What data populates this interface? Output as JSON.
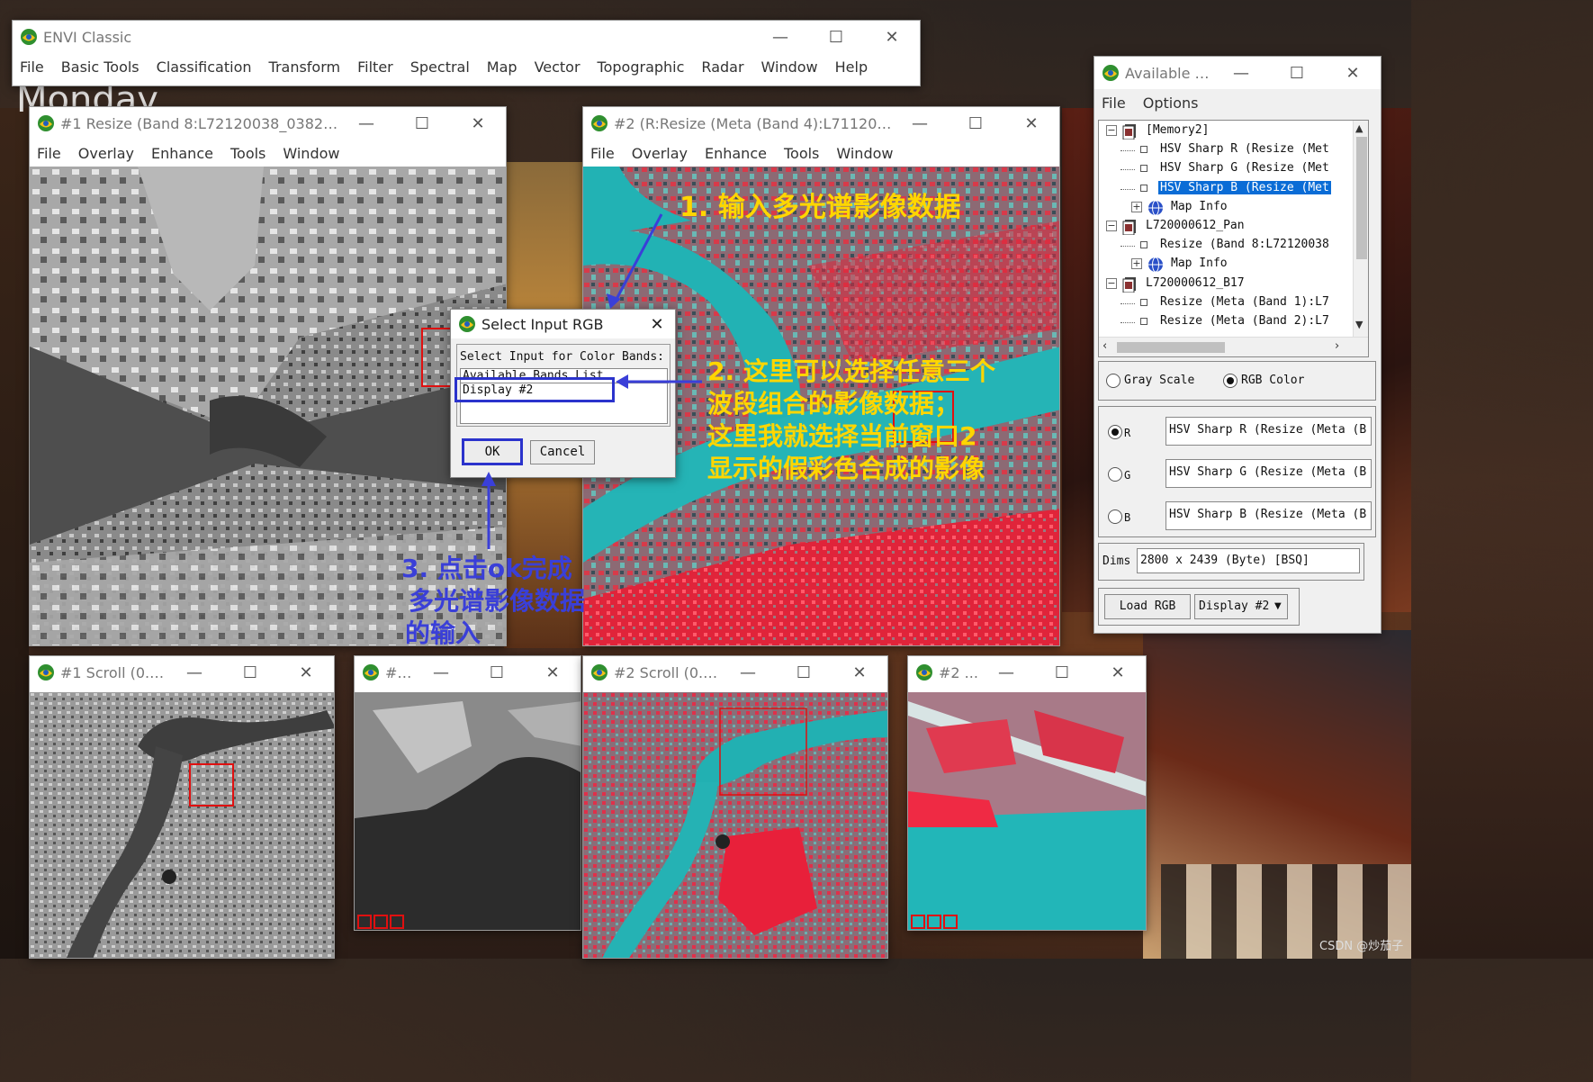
{
  "background": {
    "overlay_text": "Monday",
    "credit": "CSDN @炒茄子"
  },
  "main_window": {
    "title": "ENVI Classic",
    "menu": [
      "File",
      "Basic Tools",
      "Classification",
      "Transform",
      "Filter",
      "Spectral",
      "Map",
      "Vector",
      "Topographic",
      "Radar",
      "Window",
      "Help"
    ]
  },
  "window_controls": {
    "minimize": "—",
    "maximize": "☐",
    "close": "✕"
  },
  "display1": {
    "title": "#1 Resize (Band 8:L72120038_038200...",
    "menu": [
      "File",
      "Overlay",
      "Enhance",
      "Tools",
      "Window"
    ]
  },
  "display2": {
    "title": "#2 (R:Resize (Meta (Band 4):L7112003...",
    "menu": [
      "File",
      "Overlay",
      "Enhance",
      "Tools",
      "Window"
    ]
  },
  "scroll1": {
    "title": "#1 Scroll (0.0..."
  },
  "zoom1": {
    "title": "#1 ..."
  },
  "scroll2": {
    "title": "#2 Scroll (0.1..."
  },
  "zoom2": {
    "title": "#2 ..."
  },
  "dialog": {
    "title": "Select Input RGB",
    "prompt": "Select Input for Color Bands:",
    "list_header": "Available Bands List",
    "list_item": "Display #2",
    "ok": "OK",
    "cancel": "Cancel",
    "close": "✕"
  },
  "bands_panel": {
    "title": "Available B...",
    "menu": [
      "File",
      "Options"
    ],
    "tree": [
      {
        "text": "[Memory2]",
        "indent": 0,
        "node": "minus",
        "icon": "file",
        "selected": false
      },
      {
        "text": "HSV Sharp R (Resize (Met",
        "indent": 1,
        "node": "leaf",
        "icon": "box",
        "selected": false
      },
      {
        "text": "HSV Sharp G (Resize (Met",
        "indent": 1,
        "node": "leaf",
        "icon": "box",
        "selected": false
      },
      {
        "text": "HSV Sharp B (Resize (Met",
        "indent": 1,
        "node": "leaf",
        "icon": "box",
        "selected": true
      },
      {
        "text": "Map Info",
        "indent": 1,
        "node": "plus",
        "icon": "globe",
        "selected": false
      },
      {
        "text": "L720000612_Pan",
        "indent": 0,
        "node": "minus",
        "icon": "file",
        "selected": false
      },
      {
        "text": "Resize (Band 8:L72120038",
        "indent": 1,
        "node": "leaf",
        "icon": "box",
        "selected": false
      },
      {
        "text": "Map Info",
        "indent": 1,
        "node": "plus",
        "icon": "globe",
        "selected": false
      },
      {
        "text": "L720000612_B17",
        "indent": 0,
        "node": "minus",
        "icon": "file",
        "selected": false
      },
      {
        "text": "Resize (Meta (Band 1):L7",
        "indent": 1,
        "node": "leaf",
        "icon": "box",
        "selected": false
      },
      {
        "text": "Resize (Meta (Band 2):L7",
        "indent": 1,
        "node": "leaf",
        "icon": "box",
        "selected": false
      }
    ],
    "mode_gray": "Gray Scale",
    "mode_rgb": "RGB Color",
    "rgb": [
      {
        "label": "R",
        "value": "HSV Sharp R (Resize (Meta (B",
        "checked": true
      },
      {
        "label": "G",
        "value": "HSV Sharp G (Resize (Meta (B",
        "checked": false
      },
      {
        "label": "B",
        "value": "HSV Sharp B (Resize (Meta (B",
        "checked": false
      }
    ],
    "dims_label": "Dims",
    "dims_value": "2800 x 2439 (Byte) [BSQ]",
    "load_button": "Load RGB",
    "display_select": "Display #2"
  },
  "annotations": {
    "step1": "1. 输入多光谱影像数据",
    "step2": [
      "2. 这里可以选择任意三个",
      "波段组合的影像数据；",
      "这里我就选择当前窗口2",
      "显示的假彩色合成的影像"
    ],
    "step3": [
      "3. 点击ok完成",
      "多光谱影像数据",
      "的输入"
    ]
  },
  "colors": {
    "annotation_yellow": "#ffd600",
    "annotation_blue": "#3a3fd8",
    "selection": "#0a6cd6",
    "roi_red": "#e01010"
  }
}
